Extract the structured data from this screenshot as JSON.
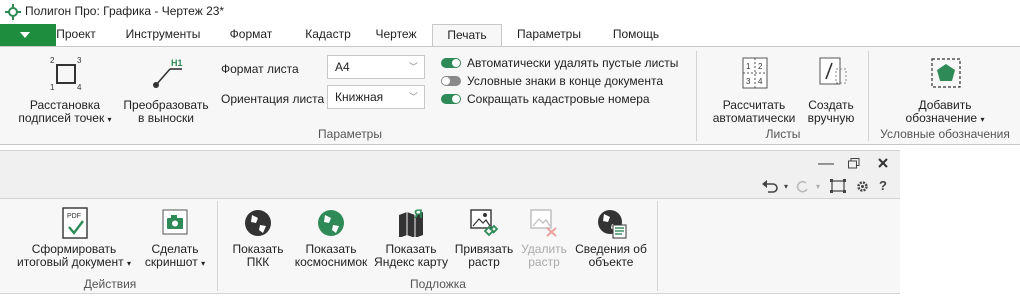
{
  "window": {
    "title": "Полигон Про: Графика - Чертеж 23*"
  },
  "tabs": [
    {
      "label": "Проект",
      "active": false
    },
    {
      "label": "Инструменты",
      "active": false
    },
    {
      "label": "Формат",
      "active": false
    },
    {
      "label": "Кадастр",
      "active": false
    },
    {
      "label": "Чертеж",
      "active": false
    },
    {
      "label": "Печать",
      "active": true
    },
    {
      "label": "Параметры",
      "active": false
    },
    {
      "label": "Помощь",
      "active": false
    }
  ],
  "ribbon": {
    "placement_line1": "Расстановка",
    "placement_line2": "подписей точек",
    "convert_line1": "Преобразовать",
    "convert_line2": "в выноски",
    "format_label": "Формат листа",
    "format_value": "A4",
    "orientation_label": "Ориентация листа",
    "orientation_value": "Книжная",
    "toggles": [
      {
        "label": "Автоматически удалять пустые листы",
        "on": true
      },
      {
        "label": "Условные знаки в конце документа",
        "on": false
      },
      {
        "label": "Сокращать кадастровые номера",
        "on": true
      }
    ],
    "group_params": "Параметры",
    "calc_line1": "Рассчитать",
    "calc_line2": "автоматически",
    "manual_line1": "Создать",
    "manual_line2": "вручную",
    "group_sheets": "Листы",
    "add_line1": "Добавить",
    "add_line2": "обозначение",
    "group_symbols": "Условные обозначения",
    "sheet_numbers": [
      "1",
      "2",
      "3",
      "4"
    ],
    "corner_numbers": [
      "2",
      "3",
      "1",
      "4"
    ],
    "h1_mark": "H1"
  },
  "panel2": {
    "form_line1": "Сформировать",
    "form_line2": "итоговый документ",
    "shot_line1": "Сделать",
    "shot_line2": "скриншот",
    "group_actions": "Действия",
    "pkk_line1": "Показать",
    "pkk_line2": "ПКК",
    "sat_line1": "Показать",
    "sat_line2": "космоснимок",
    "yandex_line1": "Показать",
    "yandex_line2": "Яндекс карту",
    "bind_line1": "Привязать",
    "bind_line2": "растр",
    "remove_line1": "Удалить",
    "remove_line2": "растр",
    "info_line1": "Сведения об",
    "info_line2": "объекте",
    "group_substrate": "Подложка",
    "pdf_tag": "PDF",
    "yandex_letter": "Я"
  },
  "colors": {
    "accent": "#1e8e3e",
    "toggle_on": "#2e8b57",
    "icon_dark": "#333333",
    "icon_green": "#2e8b57"
  }
}
